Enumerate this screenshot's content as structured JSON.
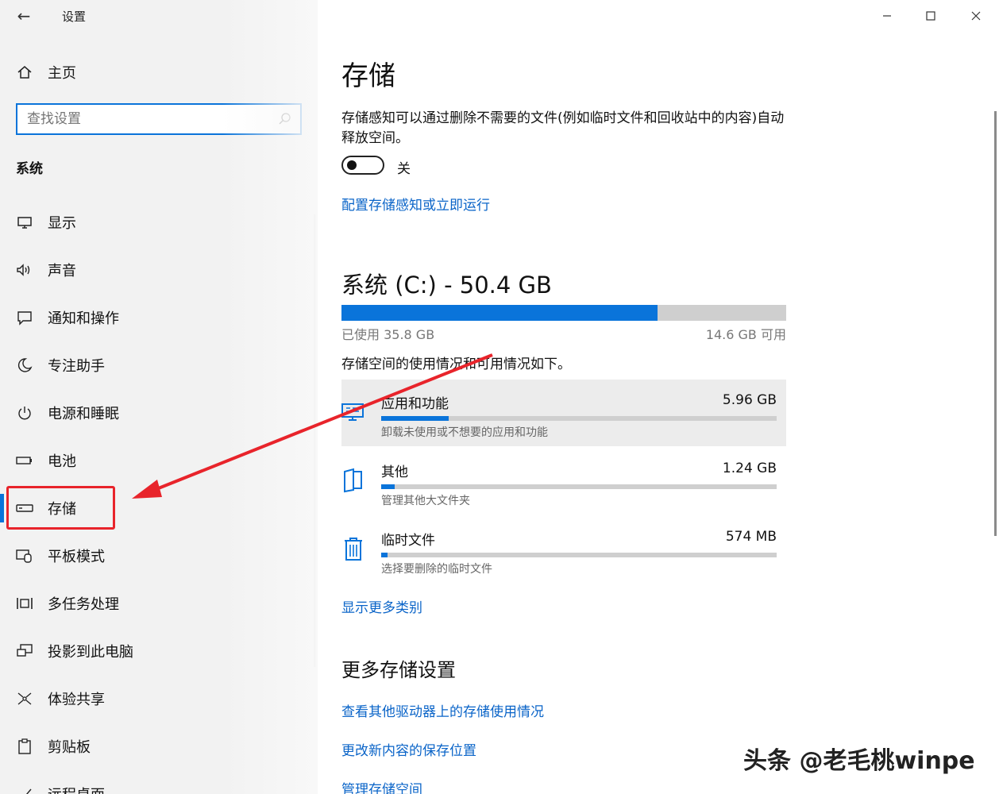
{
  "window": {
    "title": "设置",
    "controls": [
      "minimize-icon",
      "maximize-icon",
      "close-icon"
    ]
  },
  "sidebar": {
    "home_label": "主页",
    "search_placeholder": "查找设置",
    "section_label": "系统",
    "items": [
      {
        "label": "显示",
        "icon": "display-icon"
      },
      {
        "label": "声音",
        "icon": "speaker-icon"
      },
      {
        "label": "通知和操作",
        "icon": "notification-icon"
      },
      {
        "label": "专注助手",
        "icon": "moon-icon"
      },
      {
        "label": "电源和睡眠",
        "icon": "power-icon"
      },
      {
        "label": "电池",
        "icon": "battery-icon"
      },
      {
        "label": "存储",
        "icon": "storage-icon",
        "active": true
      },
      {
        "label": "平板模式",
        "icon": "tablet-icon"
      },
      {
        "label": "多任务处理",
        "icon": "multitask-icon"
      },
      {
        "label": "投影到此电脑",
        "icon": "project-icon"
      },
      {
        "label": "体验共享",
        "icon": "share-icon"
      },
      {
        "label": "剪贴板",
        "icon": "clipboard-icon"
      },
      {
        "label": "远程桌面",
        "icon": "remote-icon"
      }
    ]
  },
  "main": {
    "title": "存储",
    "storage_sense_desc": "存储感知可以通过删除不需要的文件(例如临时文件和回收站中的内容)自动释放空间。",
    "toggle_state": "关",
    "configure_link": "配置存储感知或立即运行",
    "drive": {
      "title": "系统 (C:) - 50.4 GB",
      "used_label": "已使用 35.8 GB",
      "free_label": "14.6 GB 可用",
      "used_fraction": 0.71
    },
    "usage_desc": "存储空间的使用情况和可用情况如下。",
    "categories": [
      {
        "name": "应用和功能",
        "size": "5.96 GB",
        "sub": "卸载未使用或不想要的应用和功能",
        "fraction": 0.17,
        "icon": "apps-icon"
      },
      {
        "name": "其他",
        "size": "1.24 GB",
        "sub": "管理其他大文件夹",
        "fraction": 0.035,
        "icon": "folder-icon"
      },
      {
        "name": "临时文件",
        "size": "574 MB",
        "sub": "选择要删除的临时文件",
        "fraction": 0.016,
        "icon": "trash-icon"
      }
    ],
    "show_more_link": "显示更多类别",
    "more_settings_title": "更多存储设置",
    "more_links": [
      "查看其他驱动器上的存储使用情况",
      "更改新内容的保存位置",
      "管理存储空间"
    ]
  },
  "watermark": "头条 @老毛桃winpe",
  "colors": {
    "accent": "#0a74da",
    "annotation": "#e8242b",
    "link": "#0a64c8"
  }
}
